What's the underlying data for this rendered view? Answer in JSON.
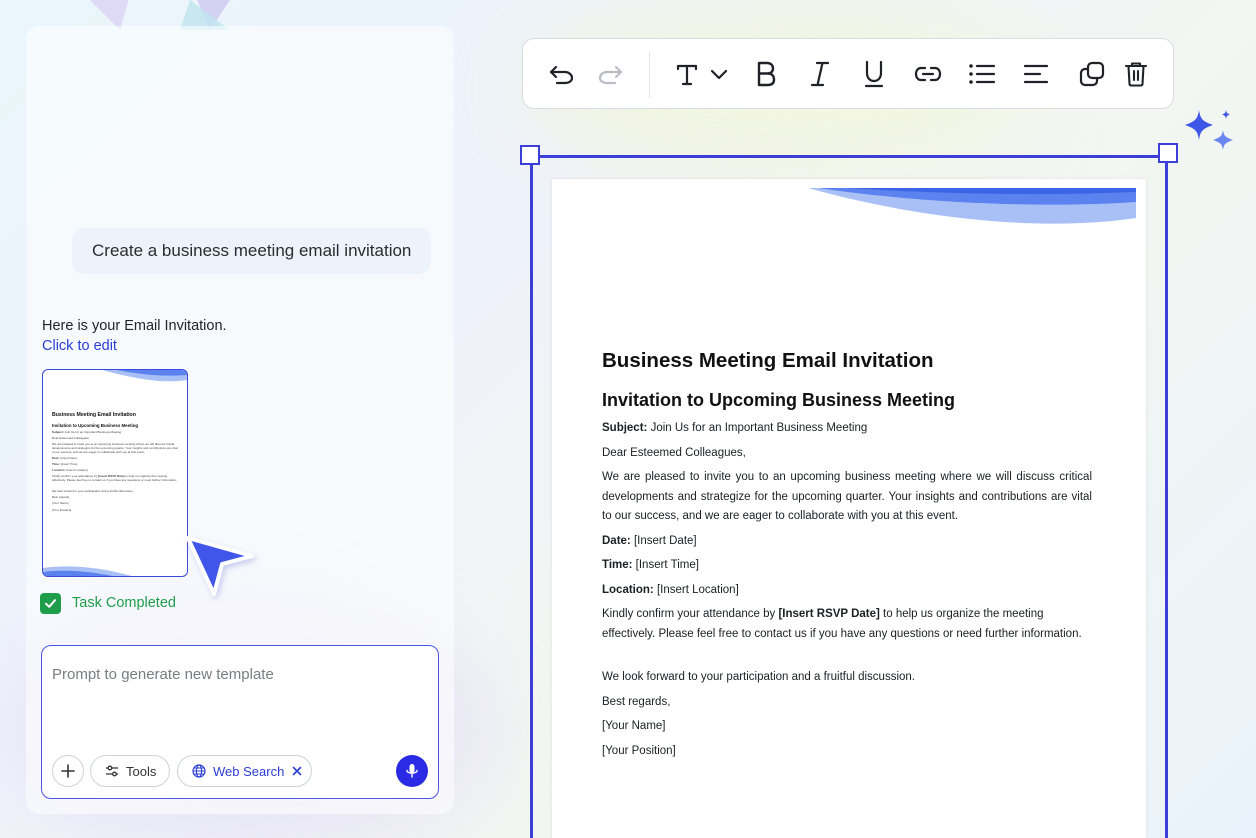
{
  "chat": {
    "user_message": "Create a business meeting email invitation",
    "reply_text": "Here is your Email Invitation.",
    "edit_link": "Click to edit",
    "task_status": "Task Completed"
  },
  "prompt": {
    "placeholder": "Prompt to generate new template",
    "tools_label": "Tools",
    "web_search_label": "Web Search"
  },
  "toolbar": {
    "icons": [
      "undo-icon",
      "redo-icon",
      "text-style-icon",
      "chevron-down-icon",
      "bold-icon",
      "italic-icon",
      "underline-icon",
      "link-icon",
      "bullet-list-icon",
      "align-left-icon",
      "duplicate-icon",
      "delete-icon"
    ]
  },
  "document": {
    "title": "Business Meeting Email Invitation",
    "subtitle": "Invitation to Upcoming Business Meeting",
    "subject_label": "Subject:",
    "subject_value": " Join Us for an Important Business Meeting",
    "greeting": "Dear Esteemed Colleagues,",
    "body": "We are pleased to invite you to an upcoming business meeting where we will discuss critical developments and strategize for the upcoming quarter. Your insights and contributions are vital to our success, and we are eager to collaborate with you at this event.",
    "date_label": "Date:",
    "date_value": " [Insert Date]",
    "time_label": "Time:",
    "time_value": " [Insert Time]",
    "location_label": "Location:",
    "location_value": " [Insert Location]",
    "rsvp_pre": "Kindly confirm your attendance by ",
    "rsvp_bold": "[Insert RSVP Date]",
    "rsvp_post": " to help us organize the meeting effectively. Please feel free to contact us if you have any questions or need further information.",
    "closing": "We look forward to your participation and a fruitful discussion.",
    "regards": "Best regards,",
    "name": "[Your Name]",
    "position": "[Your Position]"
  },
  "colors": {
    "accent": "#3b3fd8",
    "link": "#2b3ed6",
    "success": "#1e9e4b",
    "mic": "#2b2be6",
    "wave": "#5b82ee"
  }
}
